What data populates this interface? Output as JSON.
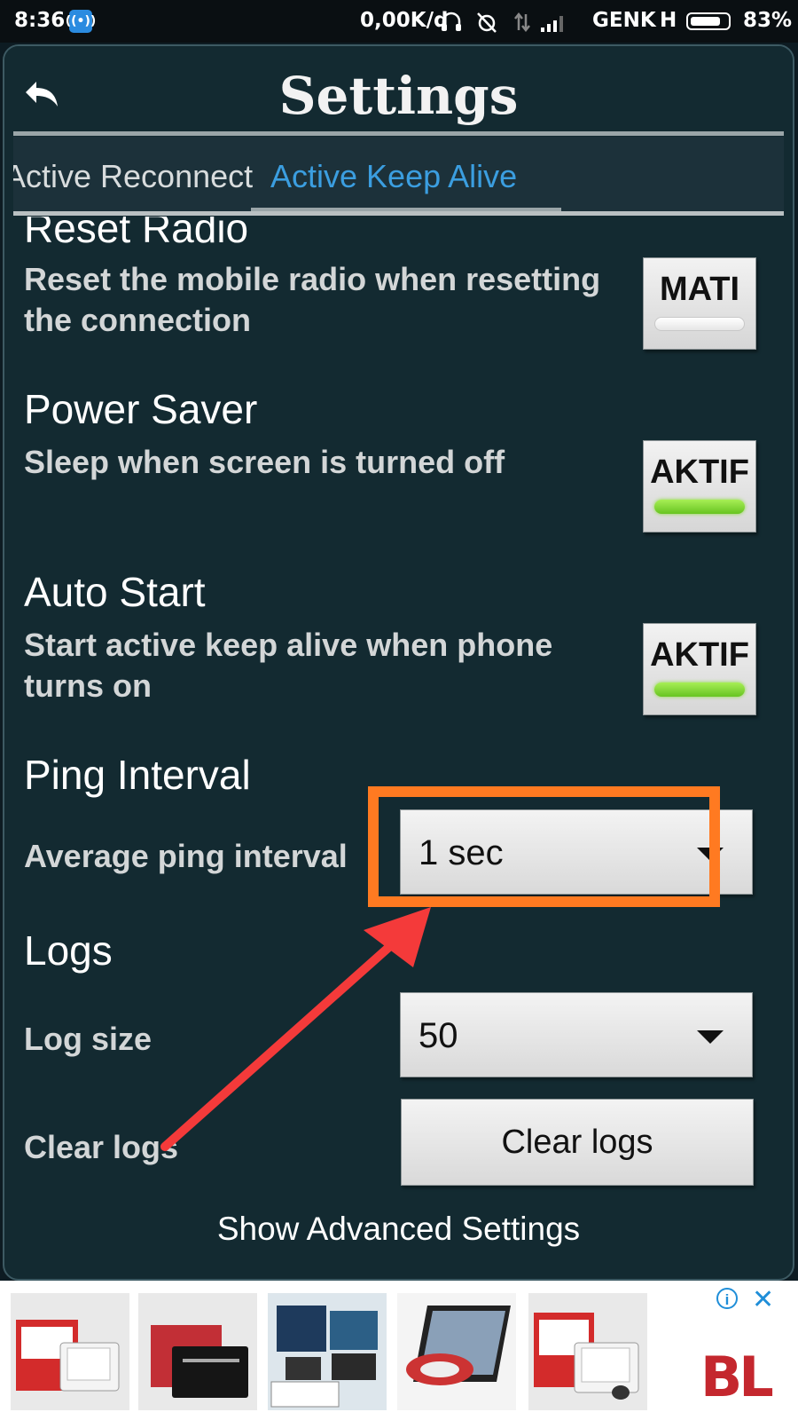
{
  "status_bar": {
    "time": "8:36",
    "speed": "0,00K/d",
    "carrier": "GENK",
    "network_type": "H",
    "battery_percent": "83%",
    "battery_level": 0.83,
    "icons": [
      "hotspot-icon",
      "headset-icon",
      "alarm-off-icon",
      "data-arrows-icon",
      "signal-icon",
      "battery-icon"
    ]
  },
  "header": {
    "title": "Settings",
    "back_icon": "back-arrow-icon"
  },
  "tabs": [
    {
      "label": "Active Reconnect",
      "active": false
    },
    {
      "label": "Active Keep Alive",
      "active": true
    }
  ],
  "settings": {
    "reset_radio": {
      "title": "Reset Radio",
      "description": "Reset the mobile radio when resetting the connection",
      "toggle_label": "MATI",
      "on": false
    },
    "power_saver": {
      "title": "Power Saver",
      "description": "Sleep when screen is turned off",
      "toggle_label": "AKTIF",
      "on": true
    },
    "auto_start": {
      "title": "Auto Start",
      "description": "Start active keep alive when phone turns on",
      "toggle_label": "AKTIF",
      "on": true
    },
    "ping_interval": {
      "title": "Ping Interval",
      "label": "Average ping interval",
      "value": "1 sec"
    },
    "logs": {
      "title": "Logs",
      "size_label": "Log size",
      "size_value": "50",
      "clear_label": "Clear logs",
      "clear_button": "Clear logs"
    },
    "advanced_link": "Show Advanced Settings"
  },
  "annotation": {
    "highlight_color": "#ff7a21",
    "arrow_color": "#f43a3a"
  },
  "ad_banner": {
    "logo": "BL",
    "info_icon": "info-icon",
    "close_icon": "close-icon",
    "product_thumbnails": [
      "drawing-tablet-box",
      "wacom-tablet",
      "softcase-tablet",
      "pen-display",
      "drawing-tablet-box"
    ]
  }
}
